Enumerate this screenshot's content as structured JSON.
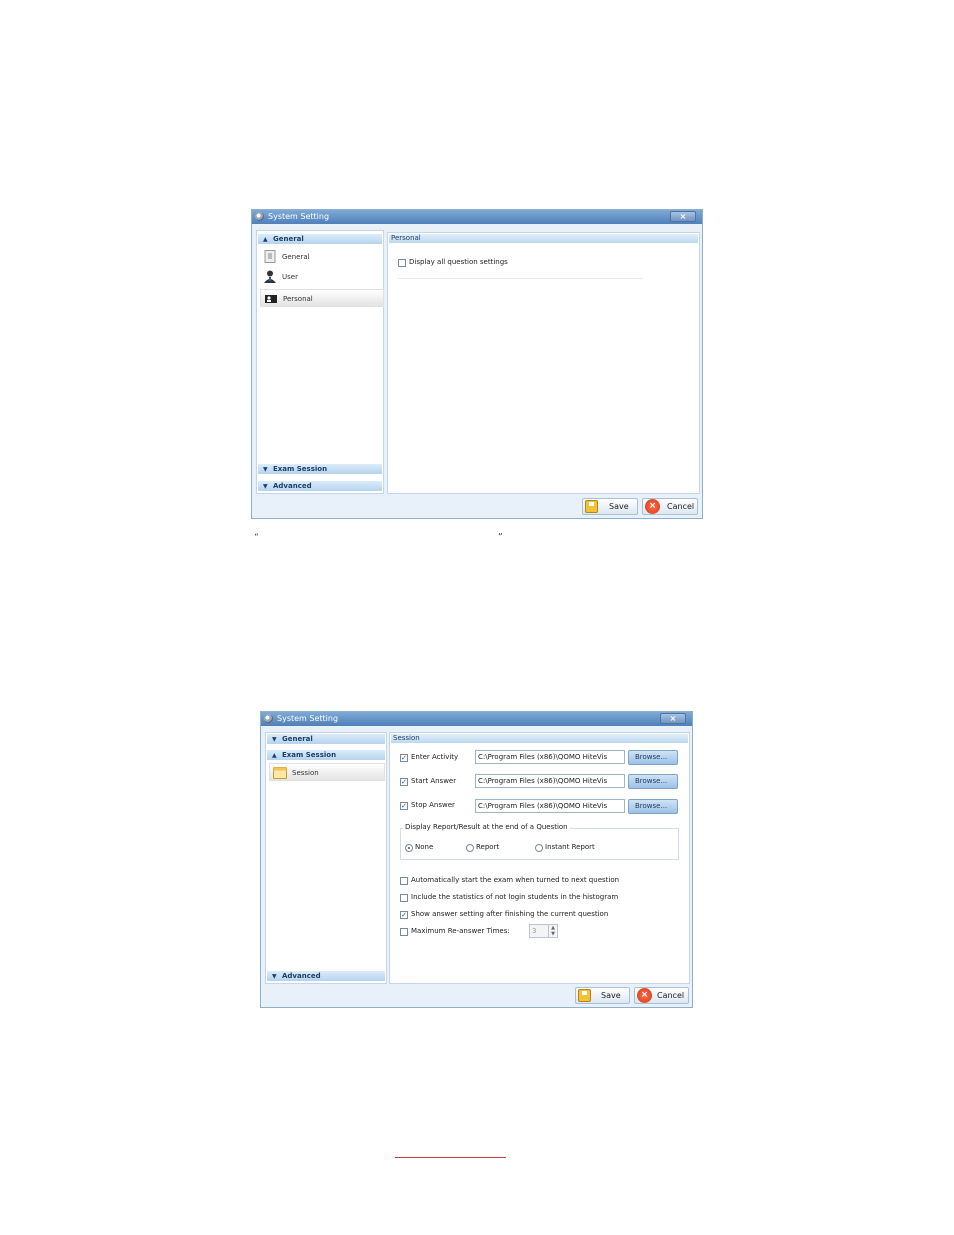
{
  "dialog1": {
    "title": "System Setting",
    "close": "×",
    "sidebar": {
      "general_header": "General",
      "items": [
        {
          "label": "General",
          "icon": "general-settings-icon"
        },
        {
          "label": "User",
          "icon": "user-icon"
        },
        {
          "label": "Personal",
          "icon": "personal-card-icon"
        }
      ],
      "exam_session_header": "Exam Session",
      "advanced_header": "Advanced"
    },
    "panel": {
      "header": "Personal",
      "display_all_label": "Display all question settings",
      "display_all_checked": false
    },
    "buttons": {
      "save": "Save",
      "cancel": "Cancel"
    }
  },
  "between_text": {
    "open_quote": "“",
    "close_quote": "”"
  },
  "dialog2": {
    "title": "System Setting",
    "close": "×",
    "sidebar": {
      "general_header": "General",
      "exam_session_header": "Exam Session",
      "items": [
        {
          "label": "Session",
          "icon": "session-folder-icon"
        }
      ],
      "advanced_header": "Advanced"
    },
    "panel": {
      "header": "Session",
      "rows": [
        {
          "label": "Enter Activity",
          "checked": true,
          "path": "C:\\Program Files (x86)\\QOMO HiteVis",
          "browse": "Browse..."
        },
        {
          "label": "Start Answer",
          "checked": true,
          "path": "C:\\Program Files (x86)\\QOMO HiteVis",
          "browse": "Browse..."
        },
        {
          "label": "Stop Answer",
          "checked": true,
          "path": "C:\\Program Files (x86)\\QOMO HiteVis",
          "browse": "Browse..."
        }
      ],
      "report_group": {
        "title": "Display Report/Result at the end of a Question",
        "options": [
          "None",
          "Report",
          "Instant Report"
        ],
        "selected": "None"
      },
      "options": [
        {
          "label": "Automatically start the exam when turned to next question",
          "checked": false
        },
        {
          "label": "Include the statistics of not login students in the histogram",
          "checked": false
        },
        {
          "label": "Show answer setting after finishing the current question",
          "checked": true
        },
        {
          "label": "Maximum Re-answer Times:",
          "checked": false
        }
      ],
      "max_reanswer_value": "3"
    },
    "buttons": {
      "save": "Save",
      "cancel": "Cancel"
    }
  },
  "colors": {
    "titlebar": "#4f7fb8",
    "dialog_bg": "#e8f1f9",
    "header_text": "#1d3f66",
    "cancel_red": "#d23a12",
    "save_yellow": "#f3c237",
    "link_red": "#c04040"
  }
}
